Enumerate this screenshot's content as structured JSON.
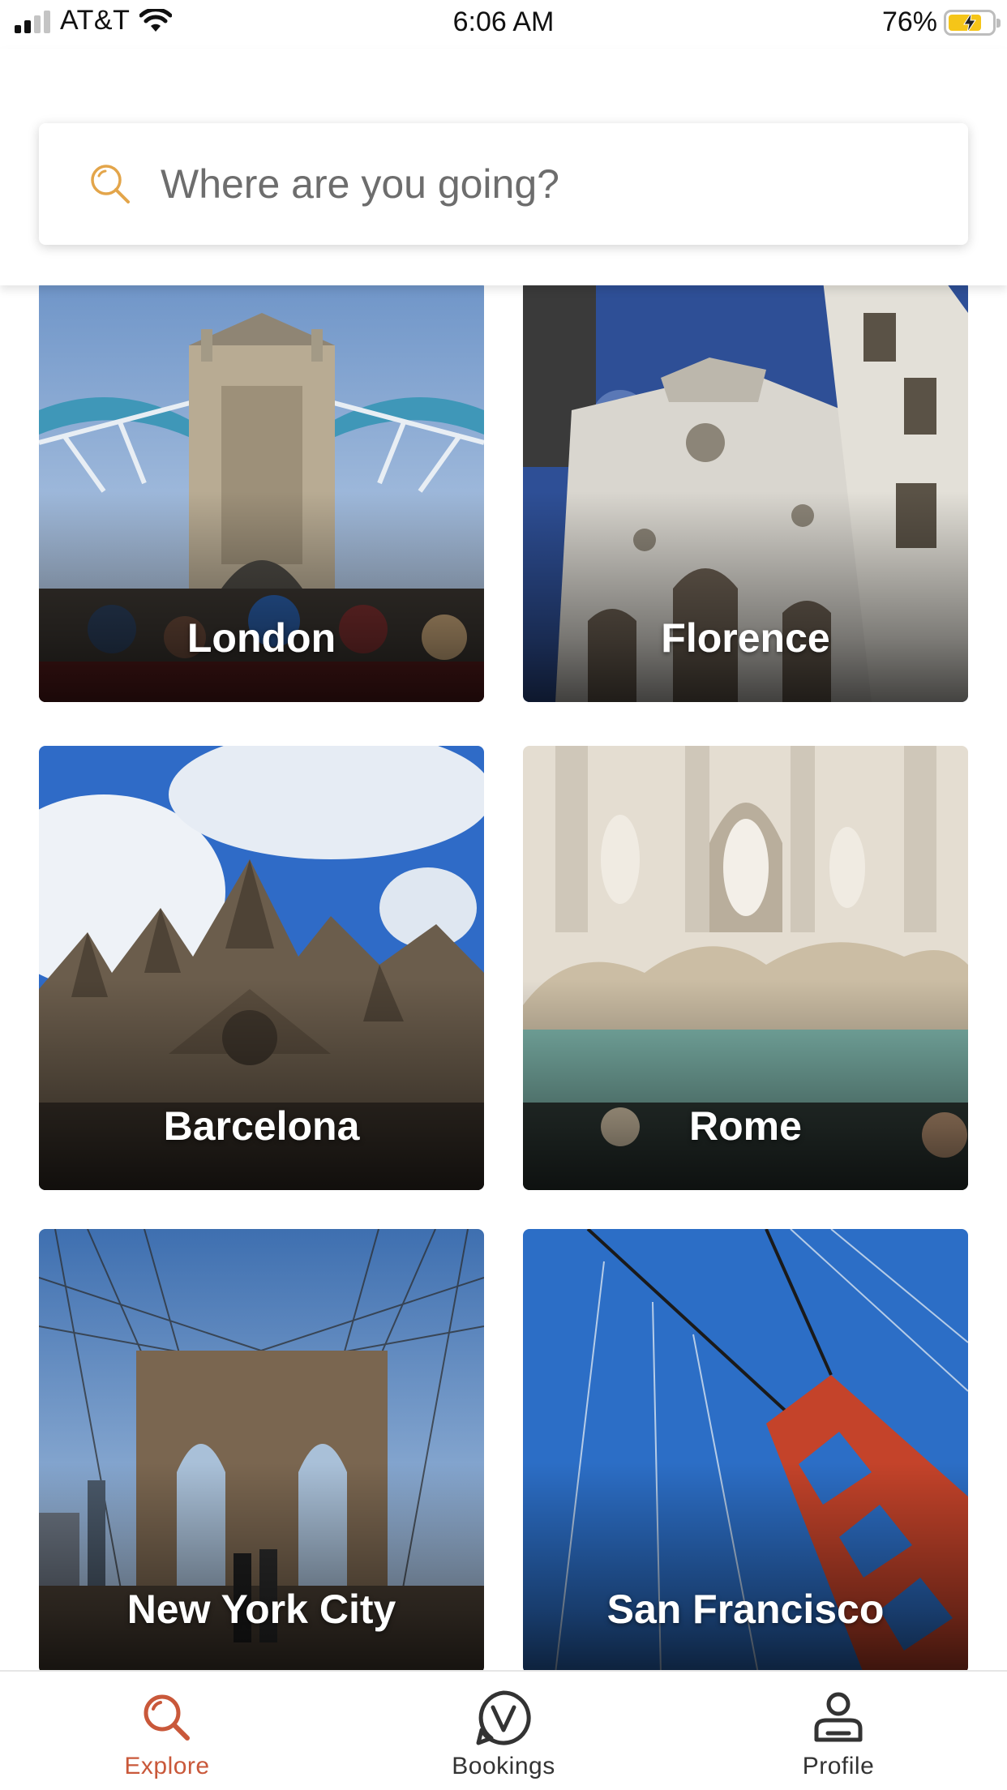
{
  "status_bar": {
    "carrier": "AT&T",
    "time": "6:06 AM",
    "battery_percent": "76%",
    "battery_level": 0.76
  },
  "search": {
    "placeholder": "Where are you going?",
    "value": ""
  },
  "destinations": [
    {
      "city": "London"
    },
    {
      "city": "Florence"
    },
    {
      "city": "Barcelona"
    },
    {
      "city": "Rome"
    },
    {
      "city": "New York City"
    },
    {
      "city": "San Francisco"
    }
  ],
  "tabs": [
    {
      "label": "Explore",
      "icon": "search-icon",
      "active": true
    },
    {
      "label": "Bookings",
      "icon": "bookings-v-icon",
      "active": false
    },
    {
      "label": "Profile",
      "icon": "profile-icon",
      "active": false
    }
  ],
  "colors": {
    "accent": "#c9583a",
    "search_icon": "#e3a54a",
    "battery_fill": "#f5c518"
  }
}
